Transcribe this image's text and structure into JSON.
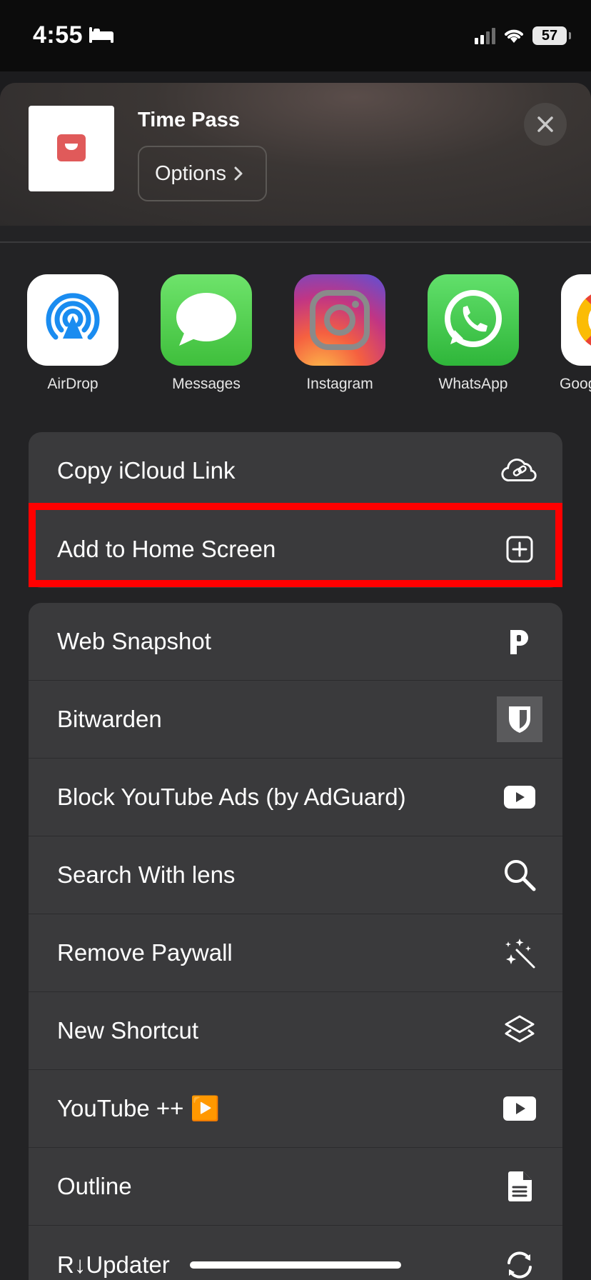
{
  "status_bar": {
    "time": "4:55",
    "battery": "57"
  },
  "share_header": {
    "title": "Time Pass",
    "options_label": "Options"
  },
  "apps": [
    {
      "label": "AirDrop",
      "icon": "airdrop-icon"
    },
    {
      "label": "Messages",
      "icon": "messages-icon"
    },
    {
      "label": "Instagram",
      "icon": "instagram-icon"
    },
    {
      "label": "WhatsApp",
      "icon": "whatsapp-icon"
    },
    {
      "label": "Goog",
      "icon": "google-icon"
    }
  ],
  "actions_group1": [
    {
      "label": "Copy iCloud Link",
      "icon": "icloud-link-icon"
    },
    {
      "label": "Add to Home Screen",
      "icon": "add-square-icon"
    }
  ],
  "actions_group2": [
    {
      "label": "Web Snapshot",
      "icon": "snapshot-p-icon"
    },
    {
      "label": "Bitwarden",
      "icon": "bitwarden-shield-icon"
    },
    {
      "label": "Block YouTube Ads (by AdGuard)",
      "icon": "youtube-play-icon"
    },
    {
      "label": "Search With lens",
      "icon": "magnifier-icon"
    },
    {
      "label": "Remove Paywall",
      "icon": "magic-wand-icon"
    },
    {
      "label": "New Shortcut",
      "icon": "shortcuts-layers-icon"
    },
    {
      "label": "YouTube ++ ▶️",
      "icon": "youtube-play-icon"
    },
    {
      "label": "Outline",
      "icon": "document-icon"
    },
    {
      "label": "R↓Updater",
      "icon": "refresh-icon"
    }
  ],
  "colors": {
    "highlight": "#ff0000",
    "sheet_bg": "#232325",
    "row_bg": "#3a3a3c"
  }
}
